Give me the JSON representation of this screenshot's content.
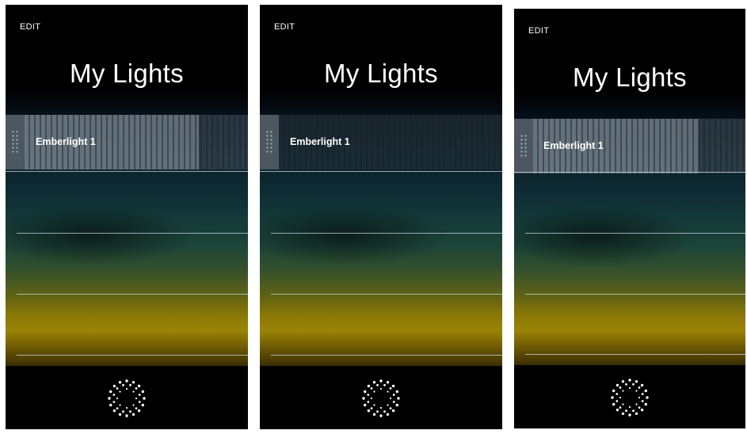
{
  "screens": [
    {
      "edit_label": "EDIT",
      "title": "My Lights",
      "lights": [
        {
          "name": "Emberlight 1",
          "brightness": 0.78
        }
      ]
    },
    {
      "edit_label": "EDIT",
      "title": "My Lights",
      "lights": [
        {
          "name": "Emberlight 1",
          "brightness": 0.0
        }
      ]
    },
    {
      "edit_label": "EDIT",
      "title": "My Lights",
      "lights": [
        {
          "name": "Emberlight 1",
          "brightness": 0.78
        }
      ]
    }
  ],
  "icons": {
    "reorder": "drag-handle-icon",
    "add_light": "sunburst-icon"
  },
  "colors": {
    "background": "#000000",
    "text": "#ffffff",
    "bar": "#808c96",
    "divider": "#c8d7e1"
  }
}
